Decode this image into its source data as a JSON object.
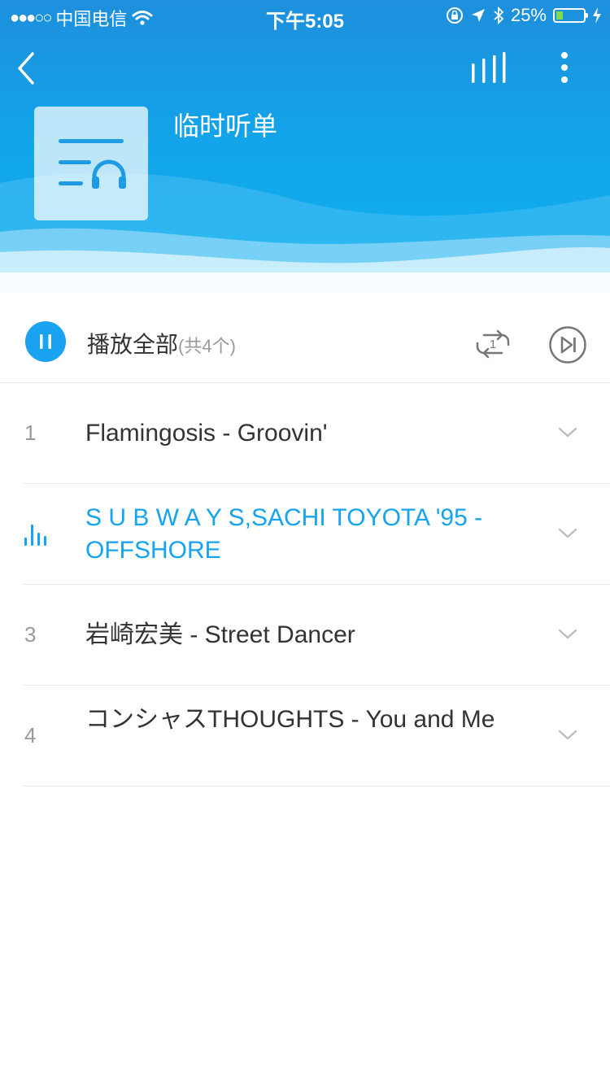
{
  "status_bar": {
    "signal": "●●●○○",
    "carrier": "中国电信",
    "time": "下午5:05",
    "battery": "25%",
    "battery_level": 0.25
  },
  "header": {
    "title": "临时听单"
  },
  "controls": {
    "play_all_label": "播放全部",
    "count_label": "(共4个)",
    "repeat_badge": "1"
  },
  "songs": [
    {
      "index": "1",
      "title": "Flamingosis - Groovin'"
    },
    {
      "index": "",
      "title": "S U B W A Y S,SACHI TOYOTA '95 - OFFSHORE",
      "playing": true
    },
    {
      "index": "3",
      "title": "岩崎宏美 - Street Dancer"
    },
    {
      "index": "4",
      "title": "コンシャスTHOUGHTS - You and Me"
    }
  ],
  "colors": {
    "accent": "#16a3ef",
    "header_top": "#1e8fdc",
    "header_bottom": "#0fb1f1"
  }
}
